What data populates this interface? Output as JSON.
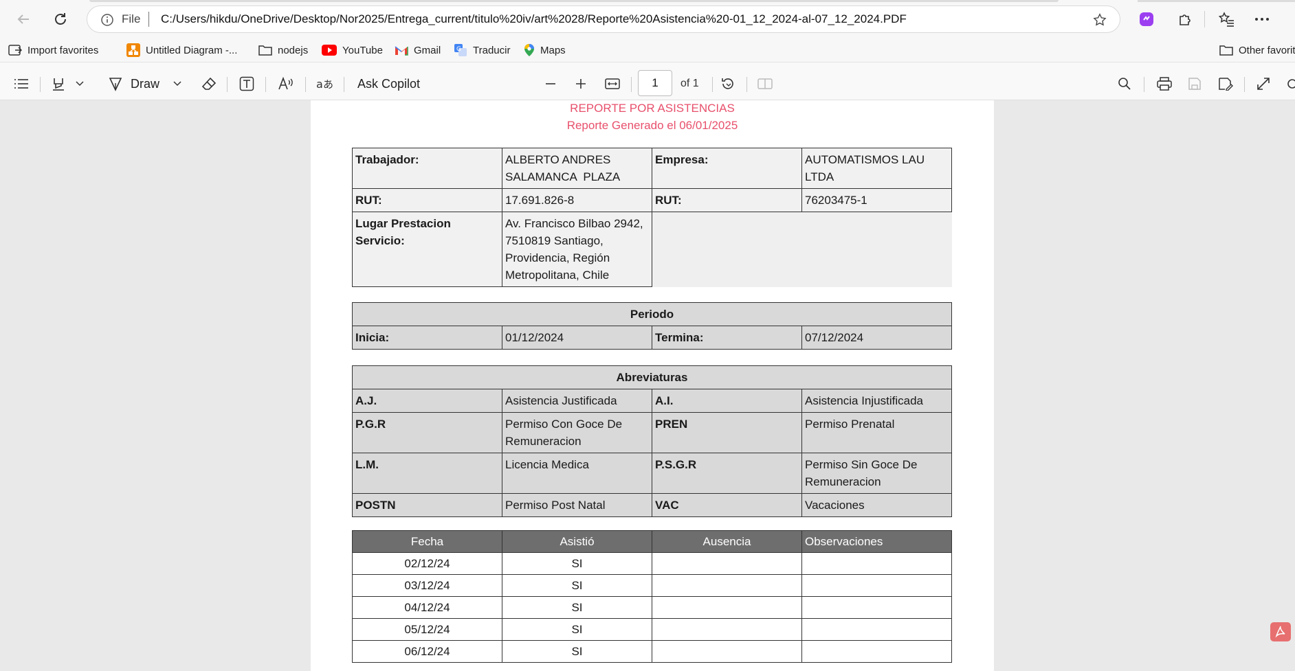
{
  "browser": {
    "address": {
      "scheme_label": "File",
      "url": "C:/Users/hikdu/OneDrive/Desktop/Nor2025/Entrega_current/titulo%20iv/art%2028/Reporte%20Asistencia%20-01_12_2024-al-07_12_2024.PDF"
    },
    "bookmarks": [
      "Import favorites",
      "Untitled Diagram -...",
      "nodejs",
      "YouTube",
      "Gmail",
      "Traducir",
      "Maps"
    ],
    "other_favorites": "Other favorit"
  },
  "pdf_toolbar": {
    "draw_label": "Draw",
    "copilot_label": "Ask Copilot",
    "page_current": "1",
    "page_of": "of 1"
  },
  "report": {
    "title": "REPORTE POR ASISTENCIAS",
    "subtitle": "Reporte Generado el 06/01/2025",
    "header": {
      "trabajador_label": "Trabajador:",
      "trabajador_line1": "ALBERTO ANDRES",
      "trabajador_line2": "SALAMANCA  PLAZA",
      "empresa_label": "Empresa:",
      "empresa_line1": "AUTOMATISMOS LAU",
      "empresa_line2": "LTDA",
      "rut_label": "RUT:",
      "rut_trabajador": "17.691.826-8",
      "rut_label_2": "RUT:",
      "rut_empresa": "76203475-1",
      "lugar_label": "Lugar Prestacion Servicio:",
      "lugar_lines": [
        "Av. Francisco Bilbao 2942,",
        "7510819 Santiago,",
        "Providencia, Región",
        "Metropolitana, Chile"
      ]
    },
    "periodo": {
      "title": "Periodo",
      "inicia_label": "Inicia:",
      "inicia": "01/12/2024",
      "termina_label": "Termina:",
      "termina": "07/12/2024"
    },
    "abreviaturas": {
      "title": "Abreviaturas",
      "rows": [
        [
          "A.J.",
          "Asistencia Justificada",
          "A.I.",
          "Asistencia Injustificada"
        ],
        [
          "P.G.R",
          "Permiso Con Goce De Remuneracion",
          "PREN",
          "Permiso Prenatal"
        ],
        [
          "L.M.",
          "Licencia Medica",
          "P.S.G.R",
          "Permiso Sin Goce De Remuneracion"
        ],
        [
          "POSTN",
          "Permiso Post Natal",
          "VAC",
          "Vacaciones"
        ]
      ]
    },
    "asistencia": {
      "columns": [
        "Fecha",
        "Asistió",
        "Ausencia",
        "Observaciones"
      ],
      "rows": [
        [
          "02/12/24",
          "SI",
          "",
          ""
        ],
        [
          "03/12/24",
          "SI",
          "",
          ""
        ],
        [
          "04/12/24",
          "SI",
          "",
          ""
        ],
        [
          "05/12/24",
          "SI",
          "",
          ""
        ],
        [
          "06/12/24",
          "SI",
          "",
          ""
        ]
      ]
    }
  }
}
